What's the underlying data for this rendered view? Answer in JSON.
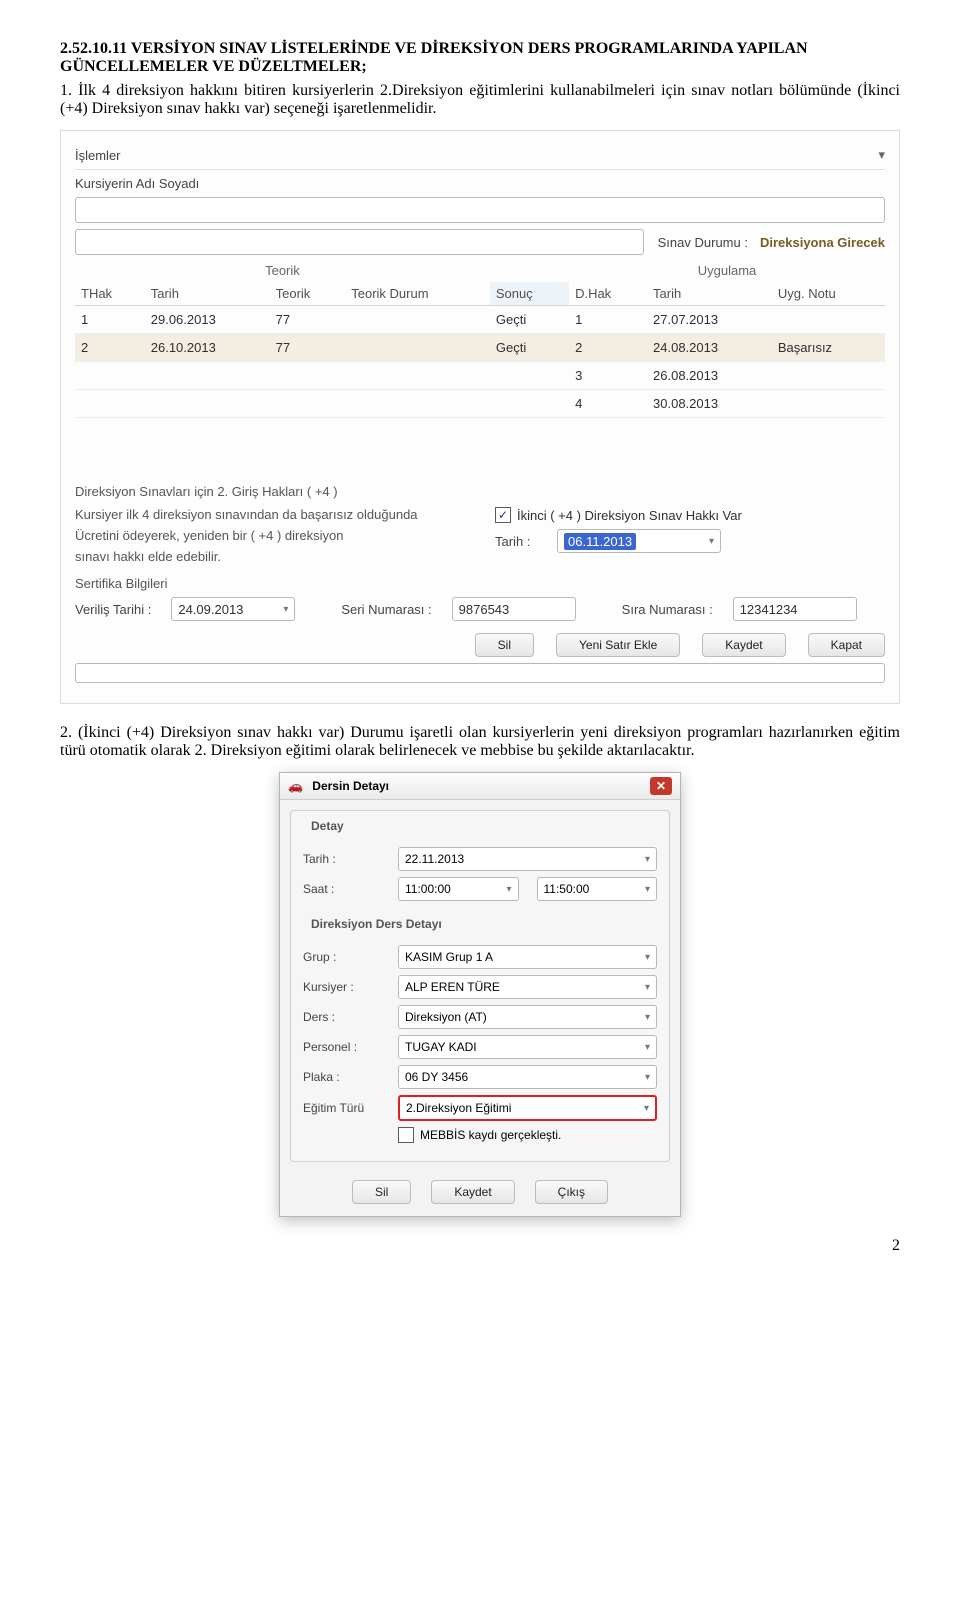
{
  "title_line1": "2.52.10.11 VERSİYON SINAV LİSTELERİNDE VE DİREKSİYON DERS PROGRAMLARINDA YAPILAN GÜNCELLEMELER VE DÜZELTMELER;",
  "para1": "1. İlk 4 direksiyon hakkını bitiren kursiyerlerin 2.Direksiyon eğitimlerini kullanabilmeleri için sınav notları bölümünde (İkinci (+4) Direksiyon sınav hakkı var) seçeneği işaretlenmelidir.",
  "form1": {
    "menu_label": "İşlemler",
    "menu_arrow": "▾",
    "kursiyer_label": "Kursiyerin Adı Soyadı",
    "sinav_durumu_label": "Sınav Durumu :",
    "sinav_durumu_value": "Direksiyona Girecek",
    "columns": {
      "thak": "THak",
      "tarih": "Tarih",
      "teorik": "Teorik",
      "teorik_durum": "Teorik Durum",
      "sonuc": "Sonuç",
      "dhak": "D.Hak",
      "tarih2": "Tarih",
      "uygnotu": "Uyg. Notu",
      "group_teorik": "Teorik",
      "group_uygulama": "Uygulama"
    },
    "rows": [
      {
        "thak": "1",
        "tarih": "29.06.2013",
        "teorik": "77",
        "durum": "",
        "sonuc": "Geçti",
        "dhak": "1",
        "tarih2": "27.07.2013",
        "uyg": ""
      },
      {
        "thak": "2",
        "tarih": "26.10.2013",
        "teorik": "77",
        "durum": "",
        "sonuc": "Geçti",
        "dhak": "2",
        "tarih2": "24.08.2013",
        "uyg": "Başarısız"
      },
      {
        "thak": "",
        "tarih": "",
        "teorik": "",
        "durum": "",
        "sonuc": "",
        "dhak": "3",
        "tarih2": "26.08.2013",
        "uyg": ""
      },
      {
        "thak": "",
        "tarih": "",
        "teorik": "",
        "durum": "",
        "sonuc": "",
        "dhak": "4",
        "tarih2": "30.08.2013",
        "uyg": ""
      }
    ],
    "giris_haklari_title": "Direksiyon Sınavları için 2. Giriş Hakları  ( +4 )",
    "note1": "Kursiyer ilk 4 direksiyon sınavından da başarısız olduğunda",
    "note2": "Ücretini ödeyerek, yeniden bir ( +4 ) direksiyon",
    "note3": "sınavı hakkı elde edebilir.",
    "ikinci_hak_check": "✓",
    "ikinci_hak_label": "İkinci ( +4 )  Direksiyon Sınav Hakkı Var",
    "tarih_label": "Tarih :",
    "tarih_value": "06.11.2013",
    "sertifika_title": "Sertifika Bilgileri",
    "verilis_label": "Veriliş Tarihi :",
    "verilis_value": "24.09.2013",
    "seri_label": "Seri Numarası :",
    "seri_value": "9876543",
    "sira_label": "Sıra Numarası :",
    "sira_value": "12341234",
    "buttons": {
      "sil": "Sil",
      "yeni": "Yeni Satır Ekle",
      "kaydet": "Kaydet",
      "kapat": "Kapat"
    }
  },
  "para2": "2. (İkinci (+4) Direksiyon sınav hakkı var) Durumu işaretli olan kursiyerlerin yeni direksiyon programları hazırlanırken eğitim türü otomatik olarak 2. Direksiyon eğitimi olarak belirlenecek ve mebbise bu şekilde aktarılacaktır.",
  "dialog": {
    "title": "Dersin Detayı",
    "icon": "🚗",
    "close": "✕",
    "group1": "Detay",
    "tarih_label": "Tarih :",
    "tarih_val": "22.11.2013",
    "saat_label": "Saat :",
    "saat_start": "11:00:00",
    "saat_end": "11:50:00",
    "group2": "Direksiyon Ders Detayı",
    "grup_label": "Grup :",
    "grup_val": "KASIM Grup 1 A",
    "kursiyer_label": "Kursiyer :",
    "kursiyer_val": "ALP EREN TÜRE",
    "ders_label": "Ders :",
    "ders_val": "Direksiyon (AT)",
    "personel_label": "Personel :",
    "personel_val": "TUGAY KADI",
    "plaka_label": "Plaka :",
    "plaka_val": "06 DY 3456",
    "egitim_label": "Eğitim Türü",
    "egitim_val": "2.Direksiyon Eğitimi",
    "mebbis_check": "",
    "mebbis_label": "MEBBİS kaydı gerçekleşti.",
    "buttons": {
      "sil": "Sil",
      "kaydet": "Kaydet",
      "cikis": "Çıkış"
    }
  },
  "page_number": "2"
}
